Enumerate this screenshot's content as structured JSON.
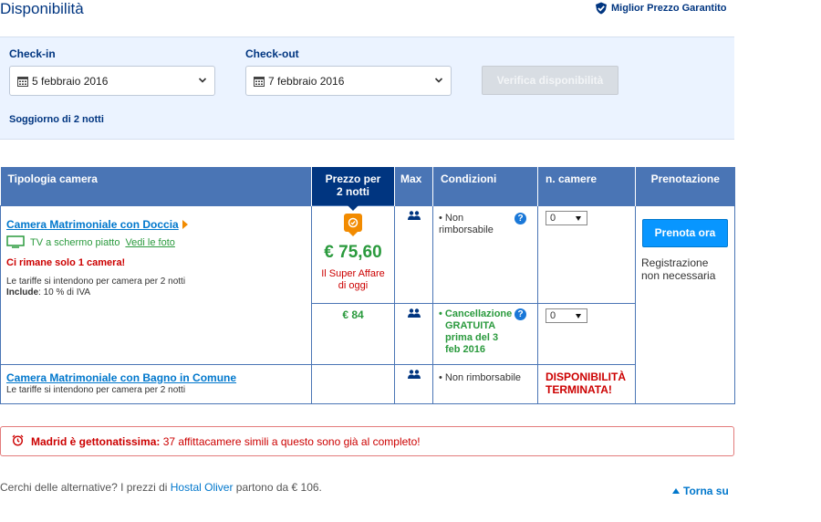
{
  "header": {
    "title": "Disponibilità",
    "guarantee": "Miglior Prezzo Garantito"
  },
  "search": {
    "checkin_label": "Check-in",
    "checkin_value": "5 febbraio 2016",
    "checkout_label": "Check-out",
    "checkout_value": "7 febbraio 2016",
    "verify_button": "Verifica disponibilità",
    "stay_text": "Soggiorno di 2 notti"
  },
  "table": {
    "headers": {
      "room_type": "Tipologia camera",
      "price_line1": "Prezzo per",
      "price_line2": "2 notti",
      "max": "Max",
      "conditions": "Condizioni",
      "rooms": "n. camere",
      "booking": "Prenotazione"
    },
    "rooms": [
      {
        "name": "Camera Matrimoniale con Doccia",
        "amenity": "TV a schermo piatto",
        "see_photos": "Vedi le foto",
        "scarcity": "Ci rimane solo 1 camera!",
        "note_line1": "Le tariffe si intendono per camera per 2 notti",
        "note_include_label": "Include",
        "note_include_value": ": 10 % di IVA",
        "offers": [
          {
            "price": "€ 75,60",
            "deal_line1": "Il Super Affare",
            "deal_line2": "di oggi",
            "condition_line1": "• Non",
            "condition_line2": "rimborsabile",
            "qty": "0"
          },
          {
            "price": "€ 84",
            "condition_line1": "• Cancellazione",
            "condition_line2": "GRATUITA",
            "condition_line3": "prima del 3",
            "condition_line4": "feb 2016",
            "qty": "0"
          }
        ]
      },
      {
        "name": "Camera Matrimoniale con Bagno in Comune",
        "note_line1": "Le tariffe si intendono per camera per 2 notti",
        "offers": [
          {
            "condition_line1": "• Non rimborsabile",
            "sold_out_line1": "DISPONIBILITÀ",
            "sold_out_line2": "TERMINATA!"
          }
        ]
      }
    ],
    "booking": {
      "button": "Prenota ora",
      "note_line1": "Registrazione",
      "note_line2": "non necessaria"
    }
  },
  "alert": {
    "bold": "Madrid è gettonatissima:",
    "text": "37 affittacamere simili a questo sono già al completo!"
  },
  "footer": {
    "alt_prefix": "Cerchi delle alternative? I prezzi di",
    "alt_hotel": "Hostal Oliver",
    "alt_suffix": "partono da € 106.",
    "back_to_top": "Torna su"
  },
  "colors": {
    "brand_dark": "#003580",
    "header_blue": "#4a75b5",
    "price_green": "#2a9a3d",
    "alert_red": "#cc0000",
    "button_blue": "#0896ff",
    "deal_orange": "#f28b00"
  }
}
